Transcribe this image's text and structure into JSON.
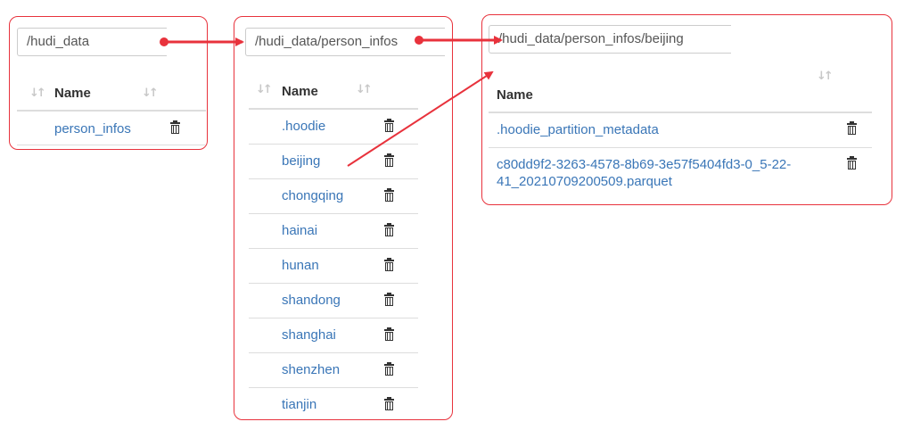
{
  "panels": [
    {
      "path": "/hudi_data",
      "column_header": "Name",
      "rows": [
        "person_infos"
      ]
    },
    {
      "path": "/hudi_data/person_infos",
      "column_header": "Name",
      "rows": [
        ".hoodie",
        "beijing",
        "chongqing",
        "hainai",
        "hunan",
        "shandong",
        "shanghai",
        "shenzhen",
        "tianjin"
      ]
    },
    {
      "path": "/hudi_data/person_infos/beijing",
      "column_header": "Name",
      "rows": [
        ".hoodie_partition_metadata",
        "c80dd9f2-3263-4578-8b69-3e57f5404fd3-0_5-22-",
        "41_20210709200509.parquet"
      ]
    }
  ],
  "annotation_color": "#e8323c",
  "link_color": "#3a76b7",
  "icons": {
    "sort": "sort-icon",
    "delete": "trash-icon",
    "arrow": "arrow-icon"
  }
}
